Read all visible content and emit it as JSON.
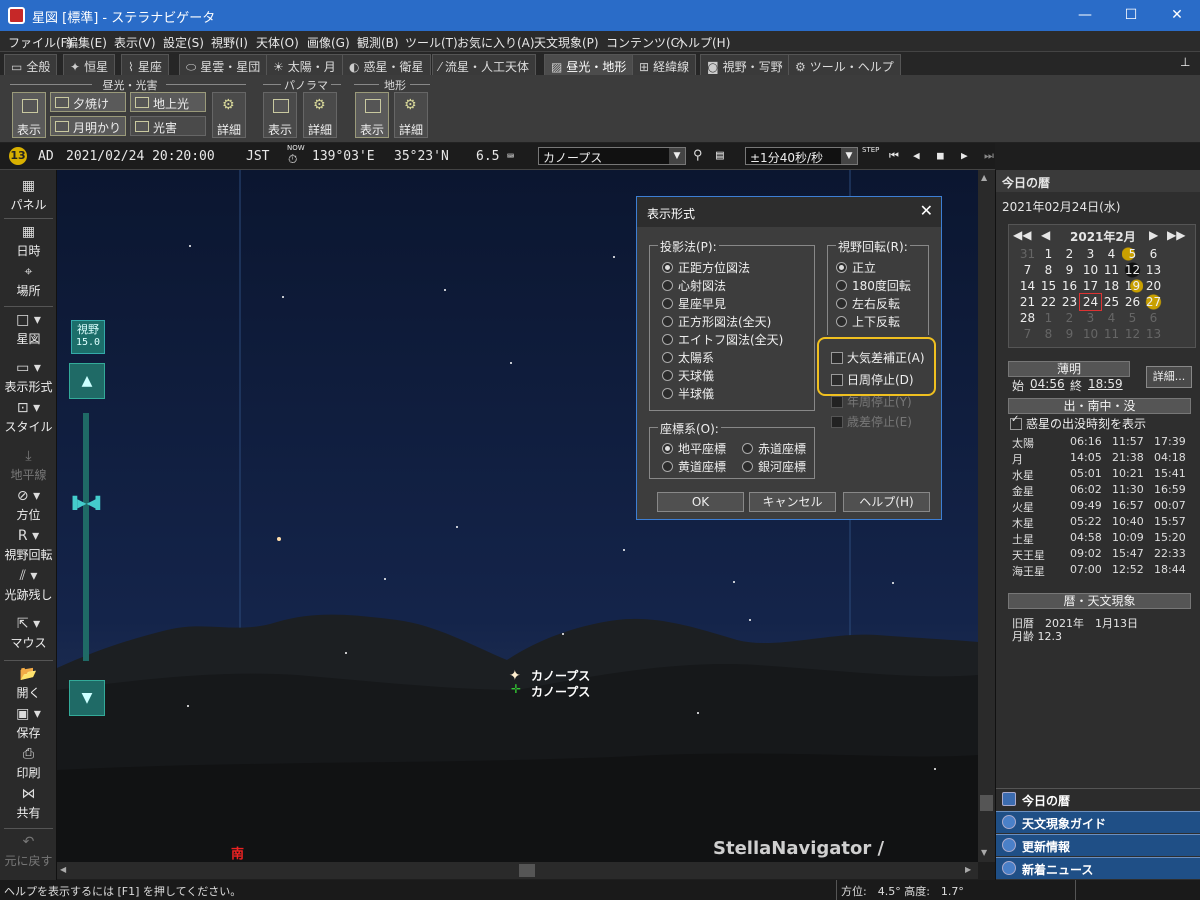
{
  "window": {
    "title": "星図 [標準] - ステラナビゲータ",
    "minimize": "—",
    "maximize": "☐",
    "close": "✕"
  },
  "menu": [
    "ファイル(F)",
    "編集(E)",
    "表示(V)",
    "設定(S)",
    "視野(I)",
    "天体(O)",
    "画像(G)",
    "観測(B)",
    "ツール(T)",
    "お気に入り(A)",
    "天文現象(P)",
    "コンテンツ(C)",
    "ヘルプ(H)"
  ],
  "tabs": [
    "全般",
    "恒星",
    "星座",
    "星雲・星団",
    "太陽・月",
    "惑星・衛星",
    "流星・人工天体",
    "昼光・地形",
    "経緯線",
    "視野・写野",
    "ツール・ヘルプ"
  ],
  "ribbon": {
    "group1": "昼光・光害",
    "group2": "パノラマ",
    "group3": "地形",
    "show": "表示",
    "detail": "詳細",
    "yuyake": "夕焼け",
    "chijoko": "地上光",
    "tsukiakari": "月明かり",
    "kogai": "光害"
  },
  "infobar": {
    "era": "AD",
    "datetime": "2021/02/24 20:20:00",
    "tz": "JST",
    "now": "NOW",
    "longitude": "139°03'E",
    "latitude": "35°23'N",
    "magnitude": "6.5",
    "target": "カノープス",
    "step": "±1分40秒/秒",
    "step_label": "STEP"
  },
  "lefttoolbar": [
    "パネル",
    "日時",
    "場所",
    "星図",
    "表示形式",
    "スタイル",
    "地平線",
    "方位",
    "視野回転",
    "光跡残し",
    "マウス",
    "開く",
    "保存",
    "印刷",
    "共有",
    "元に戻す"
  ],
  "sky": {
    "fov_label": "視野",
    "fov_value": "15.0",
    "star_label": "カノープス",
    "star_label2": "カノープス",
    "watermark": "StellaNavigator / AstroArts",
    "direction": "南"
  },
  "dialog": {
    "title": "表示形式",
    "projection_label": "投影法(P):",
    "projections": [
      "正距方位図法",
      "心射図法",
      "星座早見",
      "正方形図法(全天)",
      "エイトフ図法(全天)",
      "太陽系",
      "天球儀",
      "半球儀"
    ],
    "rotation_label": "視野回転(R):",
    "rotations": [
      "正立",
      "180度回転",
      "左右反転",
      "上下反転"
    ],
    "coord_label": "座標系(O):",
    "coords": [
      "地平座標",
      "赤道座標",
      "黄道座標",
      "銀河座標"
    ],
    "checks": [
      "大気差補正(A)",
      "日周停止(D)",
      "年周停止(Y)",
      "歳差停止(E)"
    ],
    "ok": "OK",
    "cancel": "キャンセル",
    "help": "ヘルプ(H)"
  },
  "rightpanel": {
    "header": "今日の暦",
    "date": "2021年02月24日(水)",
    "month": "2021年2月",
    "calendar": [
      [
        "31",
        "1",
        "2",
        "3",
        "4",
        "5",
        "6"
      ],
      [
        "7",
        "8",
        "9",
        "10",
        "11",
        "12",
        "13"
      ],
      [
        "14",
        "15",
        "16",
        "17",
        "18",
        "19",
        "20"
      ],
      [
        "21",
        "22",
        "23",
        "24",
        "25",
        "26",
        "27"
      ],
      [
        "28",
        "1",
        "2",
        "3",
        "4",
        "5",
        "6"
      ],
      [
        "7",
        "8",
        "9",
        "10",
        "11",
        "12",
        "13"
      ]
    ],
    "twilight_label": "薄明",
    "twilight_start_label": "始",
    "twilight_start": "04:56",
    "twilight_end_label": "終",
    "twilight_end": "18:59",
    "detail_button": "詳細...",
    "rise_set_header": "出・南中・没",
    "planet_check": "惑星の出没時刻を表示",
    "planets": [
      {
        "name": "太陽",
        "rise": "06:16",
        "transit": "11:57",
        "set": "17:39"
      },
      {
        "name": "月",
        "rise": "14:05",
        "transit": "21:38",
        "set": "04:18"
      },
      {
        "name": "水星",
        "rise": "05:01",
        "transit": "10:21",
        "set": "15:41"
      },
      {
        "name": "金星",
        "rise": "06:02",
        "transit": "11:30",
        "set": "16:59"
      },
      {
        "name": "火星",
        "rise": "09:49",
        "transit": "16:57",
        "set": "00:07"
      },
      {
        "name": "木星",
        "rise": "05:22",
        "transit": "10:40",
        "set": "15:57"
      },
      {
        "name": "土星",
        "rise": "04:58",
        "transit": "10:09",
        "set": "15:20"
      },
      {
        "name": "天王星",
        "rise": "09:02",
        "transit": "15:47",
        "set": "22:33"
      },
      {
        "name": "海王星",
        "rise": "07:00",
        "transit": "12:52",
        "set": "18:44"
      }
    ],
    "koyomi_header": "暦・天文現象",
    "kyureki": "旧暦　2021年　1月13日",
    "getsurei": "月齢 12.3",
    "nav": [
      "今日の暦",
      "天文現象ガイド",
      "更新情報",
      "新着ニュース"
    ]
  },
  "statusbar": {
    "help": "ヘルプを表示するには [F1] を押してください。",
    "azimuth": "方位:　4.5°  高度:　1.7°"
  }
}
